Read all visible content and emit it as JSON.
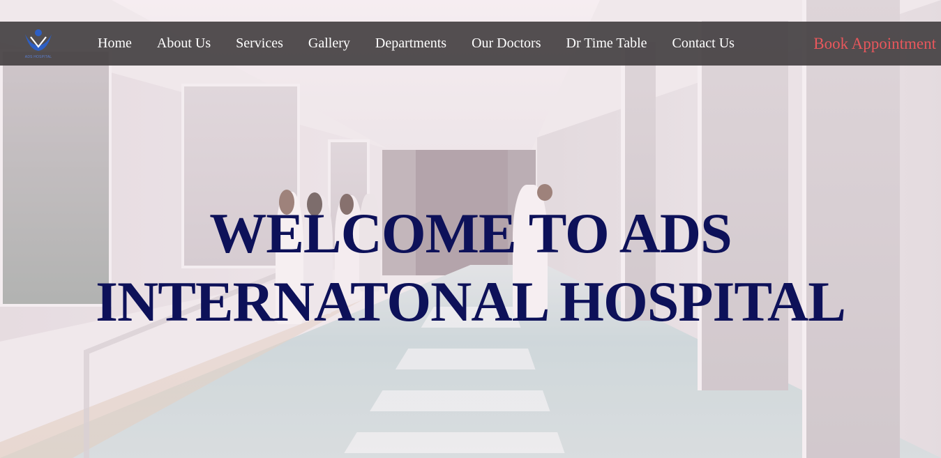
{
  "nav": {
    "logo_text": "ADS HOSPITAL",
    "links": [
      {
        "label": "Home"
      },
      {
        "label": "About Us"
      },
      {
        "label": "Services"
      },
      {
        "label": "Gallery"
      },
      {
        "label": "Departments"
      },
      {
        "label": "Our Doctors"
      },
      {
        "label": "Dr Time Table"
      },
      {
        "label": "Contact Us"
      }
    ],
    "cta_label": "Book Appointment"
  },
  "hero": {
    "title_line1": "WELCOME TO ADS",
    "title_line2": "INTERNATONAL HOSPITAL"
  },
  "colors": {
    "nav_bg": "#464244",
    "nav_text": "#ffffff",
    "cta": "#e8575c",
    "headline": "#0d1159",
    "logo": "#2d5fc4"
  }
}
